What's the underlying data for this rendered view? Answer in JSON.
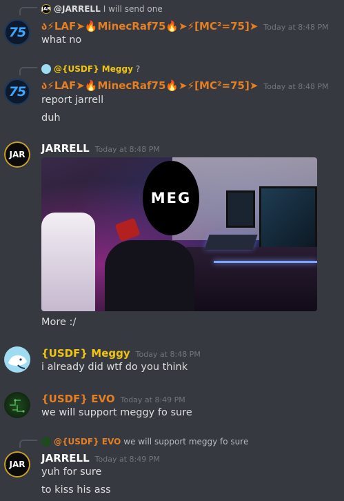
{
  "messages": [
    {
      "reply": {
        "avatar_text": "JAR",
        "name": "@JARRELL",
        "text": "I will send one"
      },
      "author": "ა⚡LAF➤🔥MinecRaf75🔥➤⚡[MC²=75]➤",
      "avatar_text": "75",
      "timestamp": "Today at 8:48 PM",
      "lines": [
        "what no"
      ]
    },
    {
      "reply": {
        "name": "@{USDF} Meggy",
        "text": "?"
      },
      "author": "ა⚡LAF➤🔥MinecRaf75🔥➤⚡[MC²=75]➤",
      "avatar_text": "75",
      "timestamp": "Today at 8:48 PM",
      "lines": [
        "report jarrell",
        "duh"
      ]
    },
    {
      "author": "JARRELL",
      "avatar_text": "JAR",
      "timestamp": "Today at 8:48 PM",
      "image_overlay_text": "MEG",
      "lines": [
        "More :/"
      ]
    },
    {
      "author": "{USDF} Meggy",
      "timestamp": "Today at 8:48 PM",
      "lines": [
        "i already did wtf do you think"
      ]
    },
    {
      "author": "{USDF} EVO",
      "timestamp": "Today at 8:49 PM",
      "lines": [
        "we will support meggy fo sure"
      ]
    },
    {
      "reply": {
        "name": "@{USDF} EVO",
        "text": "we will support meggy fo sure"
      },
      "author": "JARRELL",
      "avatar_text": "JAR",
      "timestamp": "Today at 8:49 PM",
      "lines": [
        "yuh for sure",
        "to kiss his ass"
      ]
    }
  ],
  "colors": {
    "background": "#36393f",
    "text": "#dcddde",
    "timestamp": "#72767d",
    "minecraf_name": "#e67e22",
    "meggy_name": "#f1c40f",
    "evo_name": "#e67e22",
    "jarrell_name": "#ffffff"
  }
}
